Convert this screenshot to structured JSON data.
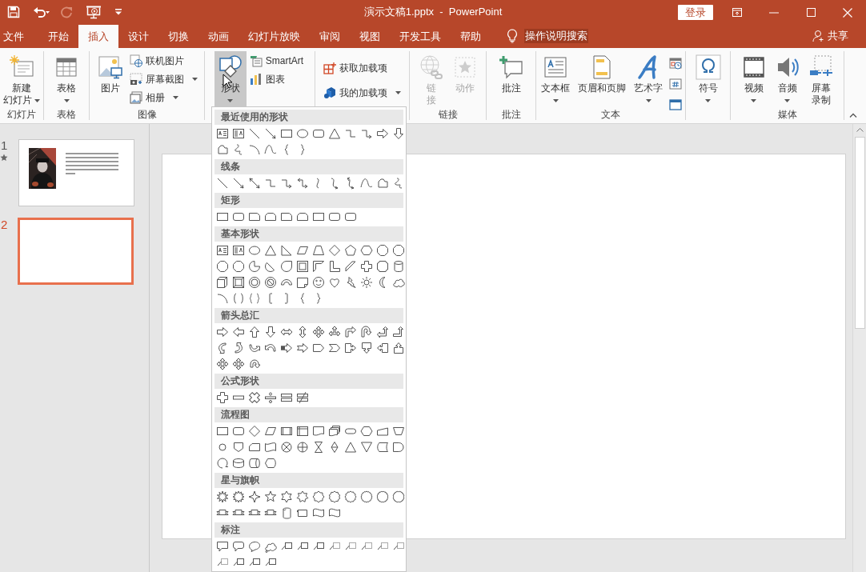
{
  "quick_access": [
    {
      "kind": "save",
      "disabled": false
    },
    {
      "kind": "undo",
      "disabled": false
    },
    {
      "kind": "redo",
      "disabled": true
    },
    {
      "kind": "present",
      "disabled": false
    },
    {
      "kind": "customize",
      "disabled": false
    }
  ],
  "window": {
    "title": "演示文稿1.pptx  -  PowerPoint",
    "sign_in": "登录"
  },
  "tabs": [
    {
      "label": "文件",
      "selected": false
    },
    {
      "label": "开始",
      "selected": false
    },
    {
      "label": "插入",
      "selected": true
    },
    {
      "label": "设计",
      "selected": false
    },
    {
      "label": "切换",
      "selected": false
    },
    {
      "label": "动画",
      "selected": false
    },
    {
      "label": "幻灯片放映",
      "selected": false
    },
    {
      "label": "审阅",
      "selected": false
    },
    {
      "label": "视图",
      "selected": false
    },
    {
      "label": "开发工具",
      "selected": false
    },
    {
      "label": "帮助",
      "selected": false
    }
  ],
  "tell_me": "操作说明搜索",
  "share": "共享",
  "ribbon_groups": [
    {
      "label": "幻灯片",
      "items": [
        {
          "kind": "large",
          "label_lines": [
            "新建",
            "幻灯片"
          ],
          "dropdown": true,
          "disabled": false,
          "pressed": false
        }
      ]
    },
    {
      "label": "表格",
      "items": [
        {
          "kind": "large",
          "label": "表格",
          "dropdown": true,
          "disabled": false,
          "pressed": false
        }
      ]
    },
    {
      "label": "图像",
      "items": [
        {
          "kind": "large",
          "label": "图片",
          "dropdown": false,
          "disabled": false,
          "pressed": false
        },
        {
          "kind": "small",
          "label": "联机图片",
          "dropdown": false,
          "disabled": false,
          "pressed": false
        },
        {
          "kind": "small",
          "label": "屏幕截图",
          "dropdown": true,
          "disabled": false,
          "pressed": false
        },
        {
          "kind": "small",
          "label": "相册",
          "dropdown": true,
          "disabled": false,
          "pressed": false
        }
      ]
    },
    {
      "items": [
        {
          "kind": "large",
          "label": "形状",
          "dropdown": true,
          "disabled": false,
          "pressed": true
        },
        {
          "kind": "small",
          "label": "SmartArt",
          "dropdown": false,
          "disabled": false,
          "pressed": false
        },
        {
          "kind": "small",
          "label": "图表",
          "dropdown": false,
          "disabled": false,
          "pressed": false
        }
      ]
    },
    {
      "items": [
        {
          "kind": "small",
          "label": "获取加载项",
          "dropdown": false,
          "disabled": false,
          "pressed": false
        },
        {
          "kind": "small",
          "label": "我的加载项",
          "dropdown": true,
          "disabled": false,
          "pressed": false
        }
      ]
    },
    {
      "label": "链接",
      "items": [
        {
          "kind": "large",
          "label_lines": [
            "链",
            "接"
          ],
          "dropdown": false,
          "disabled": true,
          "pressed": false
        },
        {
          "kind": "large",
          "label": "动作",
          "dropdown": false,
          "disabled": true,
          "pressed": false
        }
      ]
    },
    {
      "label": "批注",
      "items": [
        {
          "kind": "large",
          "label": "批注",
          "dropdown": false,
          "disabled": false,
          "pressed": false
        }
      ]
    },
    {
      "label": "文本",
      "items": [
        {
          "kind": "large",
          "label": "文本框",
          "dropdown": true,
          "disabled": false,
          "pressed": false
        },
        {
          "kind": "large",
          "label": "页眉和页脚",
          "dropdown": false,
          "disabled": false,
          "pressed": false
        },
        {
          "kind": "large",
          "label": "艺术字",
          "dropdown": true,
          "disabled": false,
          "pressed": false
        },
        {
          "kind": "icon",
          "dropdown": false,
          "disabled": false,
          "pressed": false
        },
        {
          "kind": "icon",
          "dropdown": false,
          "disabled": false,
          "pressed": false
        },
        {
          "kind": "icon",
          "dropdown": false,
          "disabled": false,
          "pressed": false
        }
      ]
    },
    {
      "items": [
        {
          "kind": "large",
          "label": "符号",
          "dropdown": true,
          "disabled": false,
          "pressed": false
        }
      ]
    },
    {
      "label": "媒体",
      "items": [
        {
          "kind": "large",
          "label": "视频",
          "dropdown": true,
          "disabled": false,
          "pressed": false
        },
        {
          "kind": "large",
          "label": "音频",
          "dropdown": true,
          "disabled": false,
          "pressed": false
        },
        {
          "kind": "large",
          "label_lines": [
            "屏幕",
            "录制"
          ],
          "dropdown": false,
          "disabled": false,
          "pressed": false
        }
      ]
    }
  ],
  "slides": [
    {
      "number": "1",
      "kind": "photo_text",
      "animated": true,
      "selected": false
    },
    {
      "number": "2",
      "kind": "blank",
      "animated": false,
      "selected": true
    }
  ],
  "shape_gallery": {
    "sections": [
      {
        "title": "最近使用的形状"
      },
      {
        "title": "线条"
      },
      {
        "title": "矩形"
      },
      {
        "title": "基本形状"
      },
      {
        "title": "箭头总汇"
      },
      {
        "title": "公式形状"
      },
      {
        "title": "流程图"
      },
      {
        "title": "星与旗帜"
      },
      {
        "title": "标注"
      }
    ]
  }
}
